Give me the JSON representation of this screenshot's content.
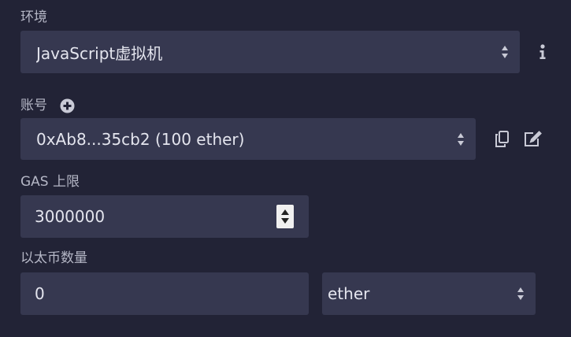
{
  "environment": {
    "label": "环境",
    "selected": "JavaScript虚拟机",
    "info_icon": "info-icon"
  },
  "account": {
    "label": "账号",
    "add_icon": "plus-circle-icon",
    "selected": "0xAb8...35cb2 (100 ether)",
    "copy_icon": "copy-icon",
    "edit_icon": "edit-icon"
  },
  "gas_limit": {
    "label": "GAS 上限",
    "value": "3000000"
  },
  "value_field": {
    "label": "以太币数量",
    "value": "0",
    "unit": "ether"
  },
  "colors": {
    "background": "#222336",
    "field": "#363850",
    "text": "#e4e5ee",
    "label": "#b5b7c6"
  }
}
